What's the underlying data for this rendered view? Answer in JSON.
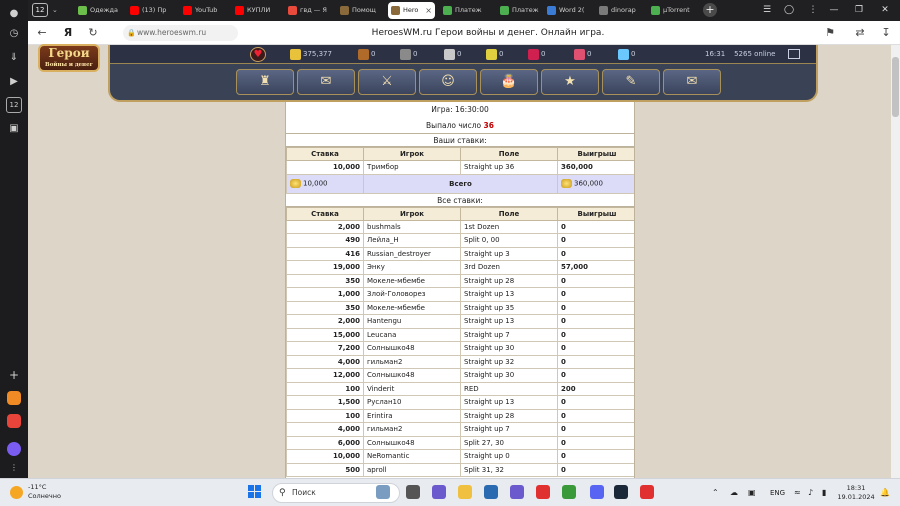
{
  "rail": {
    "icons": [
      "profile-icon",
      "history-icon",
      "downloads-icon",
      "media-play-icon",
      "tabs-12-icon",
      "screenshot-icon"
    ],
    "tabs_counter": "12",
    "add": "+"
  },
  "tabs": [
    {
      "label": "Одежда",
      "active": false,
      "color": "#6cbf4a"
    },
    {
      "label": "(13) Пр",
      "active": false,
      "color": "#ff0000"
    },
    {
      "label": "YouTub",
      "active": false,
      "color": "#ff0000"
    },
    {
      "label": "КУПЛИ",
      "active": false,
      "color": "#ff0000"
    },
    {
      "label": "гвд — Я",
      "active": false,
      "color": "#e84a3c"
    },
    {
      "label": "Помощ",
      "active": false,
      "color": "#8a6a3a"
    },
    {
      "label": "Hero",
      "active": true,
      "color": "#8a6a3a"
    },
    {
      "label": "Платеж",
      "active": false,
      "color": "#4caf50"
    },
    {
      "label": "Платеж",
      "active": false,
      "color": "#4caf50"
    },
    {
      "label": "Word 2(",
      "active": false,
      "color": "#3a7bd5"
    },
    {
      "label": "dinorap",
      "active": false,
      "color": "#7a7a7a"
    },
    {
      "label": "µTorrent",
      "active": false,
      "color": "#4caf50"
    }
  ],
  "tabbar": {
    "counter": "12",
    "new_tab": "+",
    "minimize": "—",
    "maximize": "❐",
    "close": "✕"
  },
  "address": {
    "url": "www.heroeswm.ru",
    "page_title": "HeroesWM.ru Герои войны и денег. Онлайн игра."
  },
  "header": {
    "logo_title": "Герои",
    "logo_subtitle": "Войны и денег",
    "resources": [
      {
        "name": "gold",
        "value": "375,377",
        "color": "#e8c23a"
      },
      {
        "name": "wood",
        "value": "0",
        "color": "#b06a2a"
      },
      {
        "name": "ore",
        "value": "0",
        "color": "#8a8a8a"
      },
      {
        "name": "mercury",
        "value": "0",
        "color": "#c9c9c9"
      },
      {
        "name": "sulfur",
        "value": "0",
        "color": "#e0d040"
      },
      {
        "name": "crystals",
        "value": "0",
        "color": "#d02050"
      },
      {
        "name": "gems",
        "value": "0",
        "color": "#e05070"
      },
      {
        "name": "diamonds",
        "value": "0",
        "color": "#6ac8ff"
      }
    ],
    "time": "16:31",
    "online": "5265 online"
  },
  "nav_icons": [
    "castle-icon",
    "map-icon",
    "battle-icon",
    "character-icon",
    "tavern-icon",
    "rating-icon",
    "scroll-icon",
    "chat-icon"
  ],
  "game": {
    "game_label": "Игра: 16:30:00",
    "number_prefix": "Выпало число",
    "number_value": "36",
    "your_bets_title": "Ваши ставки:",
    "all_bets_title": "Все ставки:",
    "columns": [
      "Ставка",
      "Игрок",
      "Поле",
      "Выигрыш"
    ],
    "your_bets": [
      {
        "bet": "10,000",
        "player": "Тримбор",
        "field": "Straight up 36",
        "win": "360,000"
      }
    ],
    "total": {
      "bet": "10,000",
      "label": "Всего",
      "win": "360,000"
    },
    "all_bets": [
      {
        "bet": "2,000",
        "player": "bushmals",
        "field": "1st Dozen",
        "win": "0"
      },
      {
        "bet": "490",
        "player": "Лейла_Н",
        "field": "Split 0, 00",
        "win": "0"
      },
      {
        "bet": "416",
        "player": "Russian_destroyer",
        "field": "Straight up 3",
        "win": "0"
      },
      {
        "bet": "19,000",
        "player": "Энку",
        "field": "3rd Dozen",
        "win": "57,000"
      },
      {
        "bet": "350",
        "player": "Мокеле-мбембе",
        "field": "Straight up 28",
        "win": "0"
      },
      {
        "bet": "1,000",
        "player": "Злой-Головорез",
        "field": "Straight up 13",
        "win": "0"
      },
      {
        "bet": "350",
        "player": "Мокеле-мбембе",
        "field": "Straight up 35",
        "win": "0"
      },
      {
        "bet": "2,000",
        "player": "Hantengu",
        "field": "Straight up 13",
        "win": "0"
      },
      {
        "bet": "15,000",
        "player": "Leucana",
        "field": "Straight up 7",
        "win": "0"
      },
      {
        "bet": "7,200",
        "player": "Солнышко48",
        "field": "Straight up 30",
        "win": "0"
      },
      {
        "bet": "4,000",
        "player": "гильман2",
        "field": "Straight up 32",
        "win": "0"
      },
      {
        "bet": "12,000",
        "player": "Солнышко48",
        "field": "Straight up 30",
        "win": "0"
      },
      {
        "bet": "100",
        "player": "Vinderit",
        "field": "RED",
        "win": "200"
      },
      {
        "bet": "1,500",
        "player": "Руслан10",
        "field": "Straight up 13",
        "win": "0"
      },
      {
        "bet": "100",
        "player": "Erintira",
        "field": "Straight up 28",
        "win": "0"
      },
      {
        "bet": "4,000",
        "player": "гильман2",
        "field": "Straight up 7",
        "win": "0"
      },
      {
        "bet": "6,000",
        "player": "Солнышко48",
        "field": "Split 27, 30",
        "win": "0"
      },
      {
        "bet": "10,000",
        "player": "NeRomantic",
        "field": "Straight up 0",
        "win": "0"
      },
      {
        "bet": "500",
        "player": "aproll",
        "field": "Split 31, 32",
        "win": "0"
      }
    ]
  },
  "taskbar": {
    "weather_temp": "-11°C",
    "weather_desc": "Солнечно",
    "search_placeholder": "Поиск",
    "lang": "ENG",
    "time": "18:31",
    "date": "19.01.2024",
    "apps": [
      {
        "name": "landscape-app-icon",
        "color": "#7a9cc0"
      },
      {
        "name": "file-explorer-app-icon",
        "color": "#555555"
      },
      {
        "name": "video-chat-app-icon",
        "color": "#6a5acd"
      },
      {
        "name": "folder-app-icon",
        "color": "#f0c040"
      },
      {
        "name": "store-app-icon",
        "color": "#2a6ab0"
      },
      {
        "name": "media-app-icon",
        "color": "#6a5acd"
      },
      {
        "name": "yandex-app-icon",
        "color": "#e03030"
      },
      {
        "name": "xbox-app-icon",
        "color": "#3a9a3a"
      },
      {
        "name": "discord-app-icon",
        "color": "#5865f2"
      },
      {
        "name": "steam-app-icon",
        "color": "#1b2838"
      },
      {
        "name": "yandex-browser-app-icon",
        "color": "#e03030"
      }
    ]
  }
}
